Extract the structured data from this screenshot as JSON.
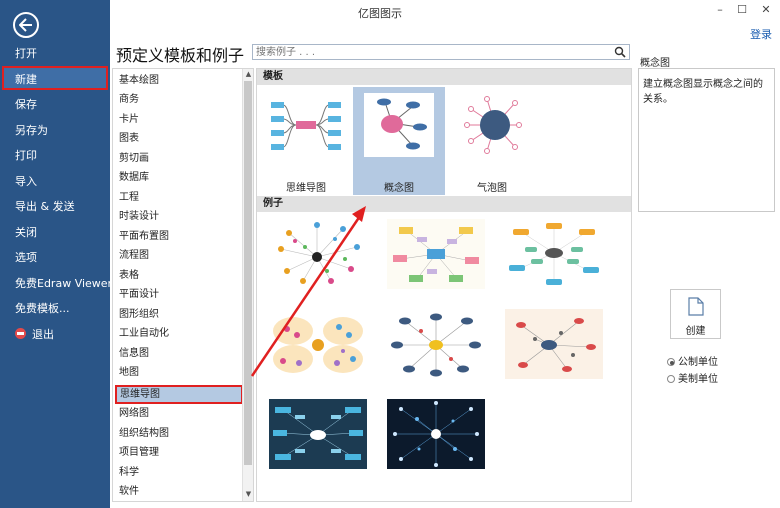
{
  "window": {
    "title": "亿图图示",
    "min_glyph": "–",
    "max_glyph": "☐",
    "close_glyph": "✕",
    "login": "登录"
  },
  "sidebar": {
    "items": [
      {
        "label": "打开"
      },
      {
        "label": "新建"
      },
      {
        "label": "保存"
      },
      {
        "label": "另存为"
      },
      {
        "label": "打印"
      },
      {
        "label": "导入"
      },
      {
        "label": "导出 & 发送"
      },
      {
        "label": "关闭"
      },
      {
        "label": "选项"
      },
      {
        "label": "免费Edraw Viewer"
      },
      {
        "label": "免费模板..."
      },
      {
        "label": "退出"
      }
    ]
  },
  "main": {
    "title": "预定义模板和例子",
    "search_placeholder": "搜索例子 . . ."
  },
  "categories": [
    "基本绘图",
    "商务",
    "卡片",
    "图表",
    "剪切画",
    "数据库",
    "工程",
    "时装设计",
    "平面布置图",
    "流程图",
    "表格",
    "平面设计",
    "图形组织",
    "工业自动化",
    "信息图",
    "地图",
    "思维导图",
    "网络图",
    "组织结构图",
    "项目管理",
    "科学",
    "软件"
  ],
  "gallery": {
    "templates_header": "模板",
    "examples_header": "例子",
    "templates": [
      {
        "label": "思维导图"
      },
      {
        "label": "概念图"
      },
      {
        "label": "气泡图"
      }
    ]
  },
  "detail": {
    "title": "概念图",
    "description": "建立概念图显示概念之间的关系。",
    "create_label": "创建",
    "unit_metric": "公制单位",
    "unit_us": "美制单位"
  },
  "colors": {
    "sidebar": "#2a5587",
    "highlight": "#b4c9e2",
    "annotation_red": "#e02020"
  }
}
